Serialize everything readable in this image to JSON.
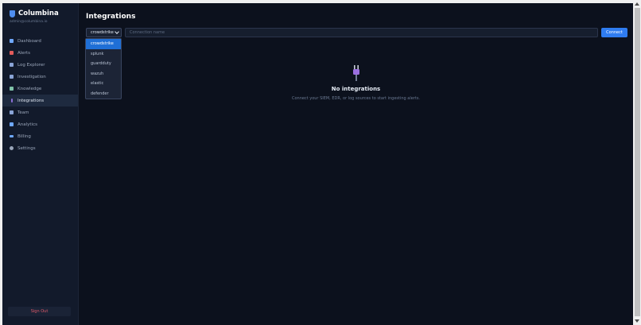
{
  "brand": {
    "name": "Columbina",
    "email": "admin@columbina.io"
  },
  "nav": {
    "items": [
      {
        "label": "Dashboard",
        "icon": "chart-icon",
        "color": "#6fa8ff"
      },
      {
        "label": "Alerts",
        "icon": "alert-icon",
        "color": "#e25b5b"
      },
      {
        "label": "Log Explorer",
        "icon": "magnifier-icon",
        "color": "#8aa4d6"
      },
      {
        "label": "Investigation",
        "icon": "search-icon",
        "color": "#8aa4d6"
      },
      {
        "label": "Knowledge",
        "icon": "book-icon",
        "color": "#7fc1a8"
      },
      {
        "label": "Integrations",
        "icon": "plug-icon",
        "color": "#8c6fd8"
      },
      {
        "label": "Team",
        "icon": "team-icon",
        "color": "#8aa4d6"
      },
      {
        "label": "Analytics",
        "icon": "analytics-icon",
        "color": "#6fa8ff"
      },
      {
        "label": "Billing",
        "icon": "card-icon",
        "color": "#6fa8ff"
      },
      {
        "label": "Settings",
        "icon": "gear-icon",
        "color": "#9aa6ba"
      }
    ],
    "active_index": 5
  },
  "sign_out_label": "Sign Out",
  "page": {
    "title": "Integrations"
  },
  "form": {
    "selected": "crowdstrike",
    "options": [
      "crowdstrike",
      "splunk",
      "guardduty",
      "wazuh",
      "elastic",
      "defender"
    ],
    "connection_placeholder": "Connection name",
    "connect_label": "Connect"
  },
  "empty_state": {
    "icon": "plug-icon",
    "title": "No integrations",
    "subtitle": "Connect your SIEM, EDR, or log sources to start ingesting alerts."
  },
  "colors": {
    "accent": "#2f7cf0",
    "background": "#0c111d",
    "sidebar": "#121a2b",
    "sign_out_text": "#e05a6a"
  }
}
